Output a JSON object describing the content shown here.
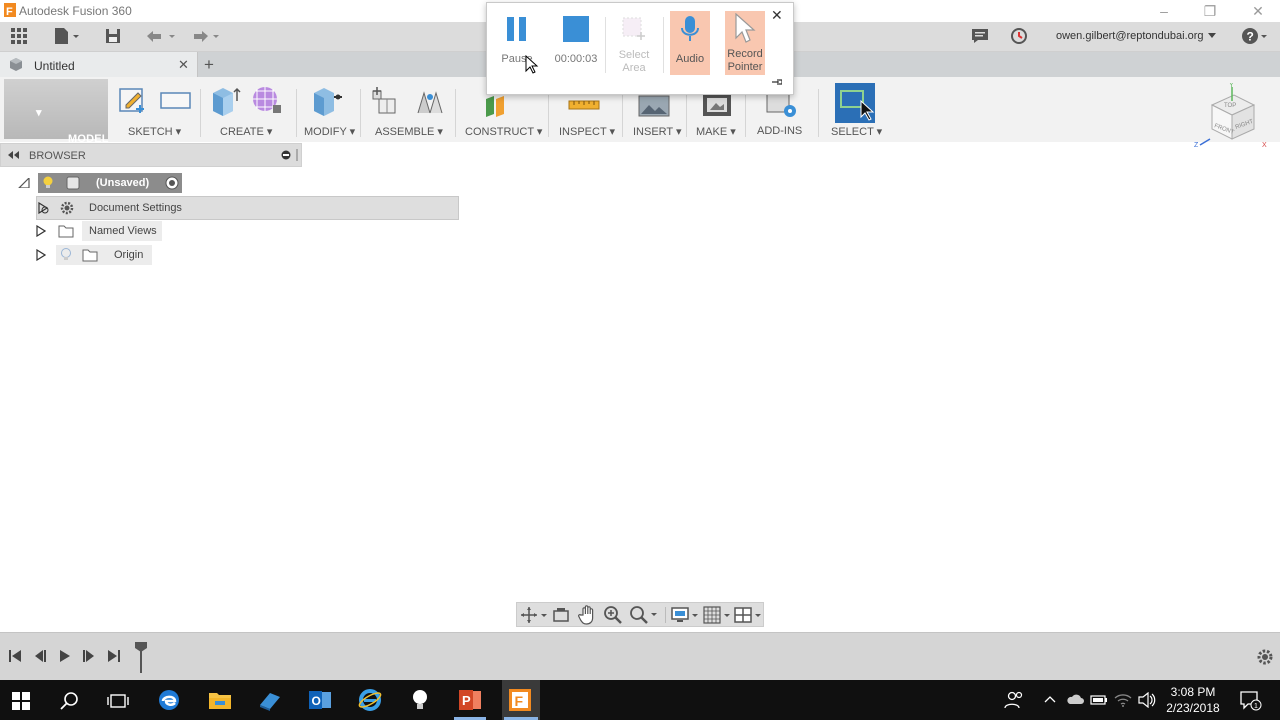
{
  "window": {
    "title": "Autodesk Fusion 360"
  },
  "quick_access": {
    "user": "owen.gilbert@reptondubai.org"
  },
  "tab": {
    "label": "Untitled"
  },
  "ribbon": {
    "workspace": "MODEL",
    "groups": {
      "sketch": "SKETCH",
      "create": "CREATE",
      "modify": "MODIFY",
      "assemble": "ASSEMBLE",
      "construct": "CONSTRUCT",
      "inspect": "INSPECT",
      "insert": "INSERT",
      "make": "MAKE",
      "addins": "ADD-INS",
      "select": "SELECT"
    }
  },
  "browser": {
    "title": "BROWSER",
    "root": "(Unsaved)",
    "items": [
      "Document Settings",
      "Named Views",
      "Origin"
    ]
  },
  "recorder": {
    "pause": "Pause",
    "timer": "00:00:03",
    "select_area_line1": "Select",
    "select_area_line2": "Area",
    "audio": "Audio",
    "record_pointer_line1": "Record",
    "record_pointer_line2": "Pointer"
  },
  "viewcube": {
    "front": "FRONT",
    "right": "RIGHT",
    "top": "TOP",
    "axis_x": "X",
    "axis_y": "Y",
    "axis_z": "Z"
  },
  "taskbar": {
    "time": "3:08 PM",
    "date": "2/23/2018"
  },
  "colors": {
    "accent_blue": "#3a8fd6",
    "recorder_highlight": "#f9c7b0",
    "select_blue": "#2b6fb6"
  }
}
